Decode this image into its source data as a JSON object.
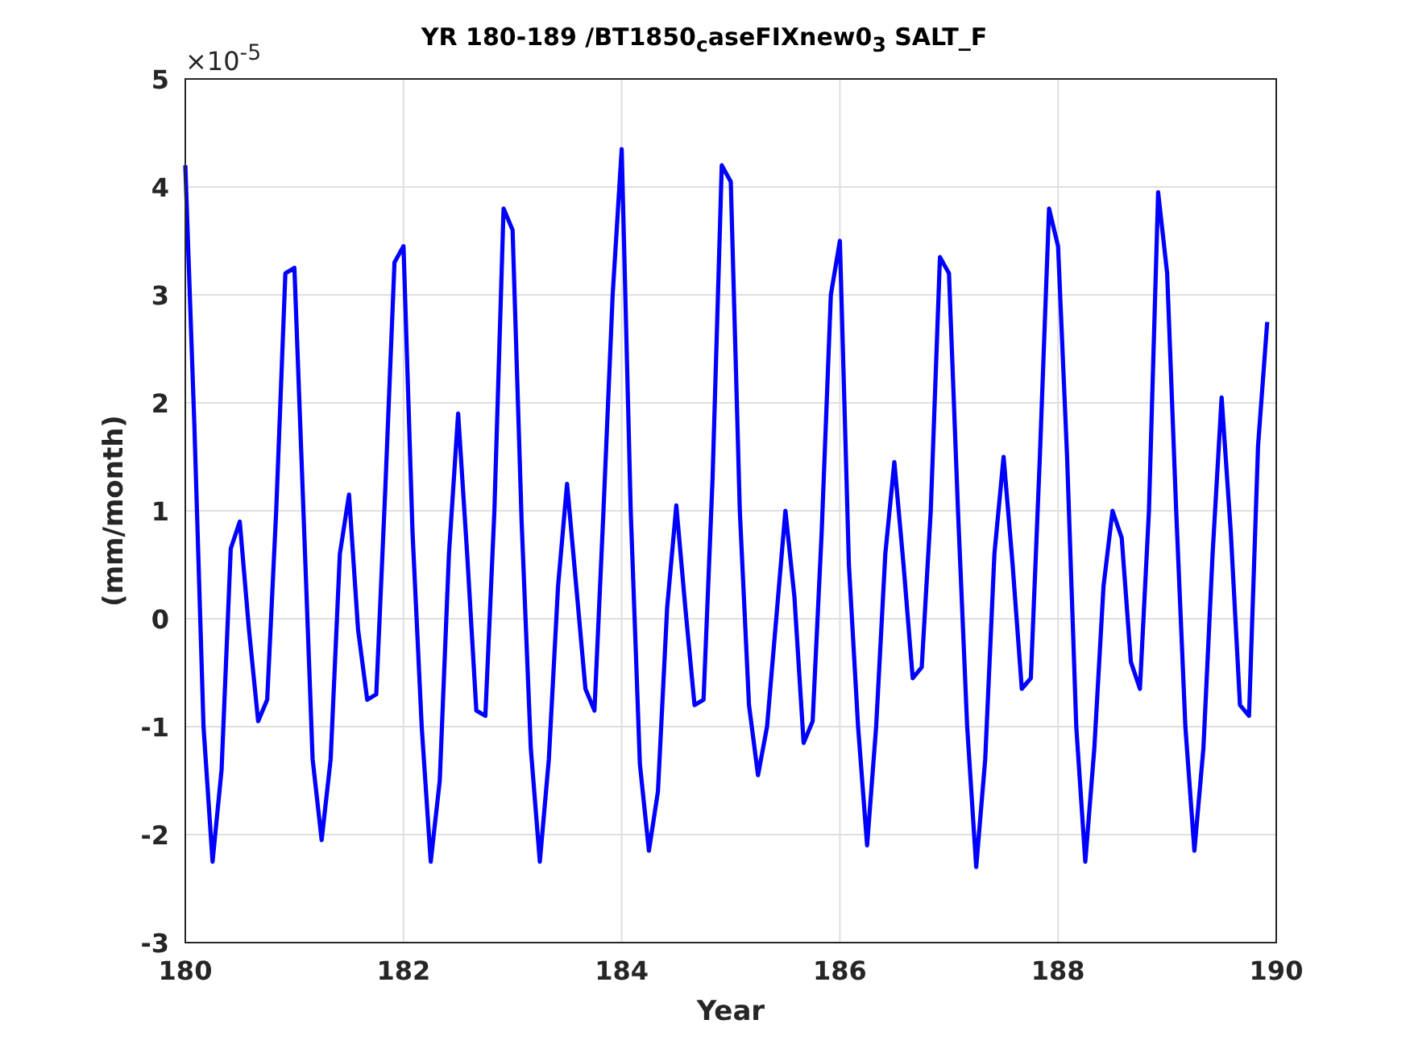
{
  "chart_data": {
    "type": "line",
    "title": "YR 180-189 /BT1850$_{c}$aseFIXnew0$_{3}$ SALT_F",
    "xlabel": "Year",
    "ylabel": "(mm/month)",
    "xlim": [
      180,
      190
    ],
    "ylim": [
      -3,
      5
    ],
    "xticks": [
      180,
      182,
      184,
      186,
      188,
      190
    ],
    "yticks": [
      -3,
      -2,
      -1,
      0,
      1,
      2,
      3,
      4,
      5
    ],
    "annotations": [
      "×10$^{-5}$"
    ],
    "grid": true,
    "x": [
      180,
      180.083,
      180.167,
      180.25,
      180.333,
      180.417,
      180.5,
      180.583,
      180.667,
      180.75,
      180.833,
      180.917,
      181,
      181.083,
      181.167,
      181.25,
      181.333,
      181.417,
      181.5,
      181.583,
      181.667,
      181.75,
      181.833,
      181.917,
      182,
      182.083,
      182.167,
      182.25,
      182.333,
      182.417,
      182.5,
      182.583,
      182.667,
      182.75,
      182.833,
      182.917,
      183,
      183.083,
      183.167,
      183.25,
      183.333,
      183.417,
      183.5,
      183.583,
      183.667,
      183.75,
      183.833,
      183.917,
      184,
      184.083,
      184.167,
      184.25,
      184.333,
      184.417,
      184.5,
      184.583,
      184.667,
      184.75,
      184.833,
      184.917,
      185,
      185.083,
      185.167,
      185.25,
      185.333,
      185.417,
      185.5,
      185.583,
      185.667,
      185.75,
      185.833,
      185.917,
      186,
      186.083,
      186.167,
      186.25,
      186.333,
      186.417,
      186.5,
      186.583,
      186.667,
      186.75,
      186.833,
      186.917,
      187,
      187.083,
      187.167,
      187.25,
      187.333,
      187.417,
      187.5,
      187.583,
      187.667,
      187.75,
      187.833,
      187.917,
      188,
      188.083,
      188.167,
      188.25,
      188.333,
      188.417,
      188.5,
      188.583,
      188.667,
      188.75,
      188.833,
      188.917,
      189,
      189.083,
      189.167,
      189.25,
      189.333,
      189.417,
      189.5,
      189.583,
      189.667,
      189.75,
      189.833,
      189.917
    ],
    "series": [
      {
        "color": "#0000ff",
        "values": [
          4.2,
          1.8,
          -1.0,
          -2.25,
          -1.4,
          0.65,
          0.9,
          -0.1,
          -0.95,
          -0.75,
          1.0,
          3.2,
          3.25,
          1.0,
          -1.3,
          -2.05,
          -1.3,
          0.6,
          1.15,
          -0.1,
          -0.75,
          -0.7,
          1.2,
          3.3,
          3.45,
          0.8,
          -1.0,
          -2.25,
          -1.5,
          0.6,
          1.9,
          0.6,
          -0.85,
          -0.9,
          1.0,
          3.8,
          3.6,
          0.9,
          -1.2,
          -2.25,
          -1.3,
          0.3,
          1.25,
          0.3,
          -0.65,
          -0.85,
          1.0,
          3.0,
          4.35,
          1.0,
          -1.35,
          -2.15,
          -1.6,
          0.1,
          1.05,
          0.1,
          -0.8,
          -0.75,
          1.3,
          4.2,
          4.05,
          1.0,
          -0.8,
          -1.45,
          -1.0,
          0.0,
          1.0,
          0.2,
          -1.15,
          -0.95,
          0.8,
          3.0,
          3.5,
          0.5,
          -1.0,
          -2.1,
          -1.0,
          0.6,
          1.45,
          0.5,
          -0.55,
          -0.45,
          1.0,
          3.35,
          3.2,
          1.0,
          -1.0,
          -2.3,
          -1.3,
          0.6,
          1.5,
          0.5,
          -0.65,
          -0.55,
          1.5,
          3.8,
          3.45,
          1.5,
          -1.0,
          -2.25,
          -1.2,
          0.3,
          1.0,
          0.75,
          -0.4,
          -0.65,
          1.0,
          3.95,
          3.2,
          1.0,
          -1.0,
          -2.15,
          -1.2,
          0.6,
          2.05,
          0.8,
          -0.8,
          -0.9,
          1.6,
          2.75
        ]
      }
    ]
  }
}
